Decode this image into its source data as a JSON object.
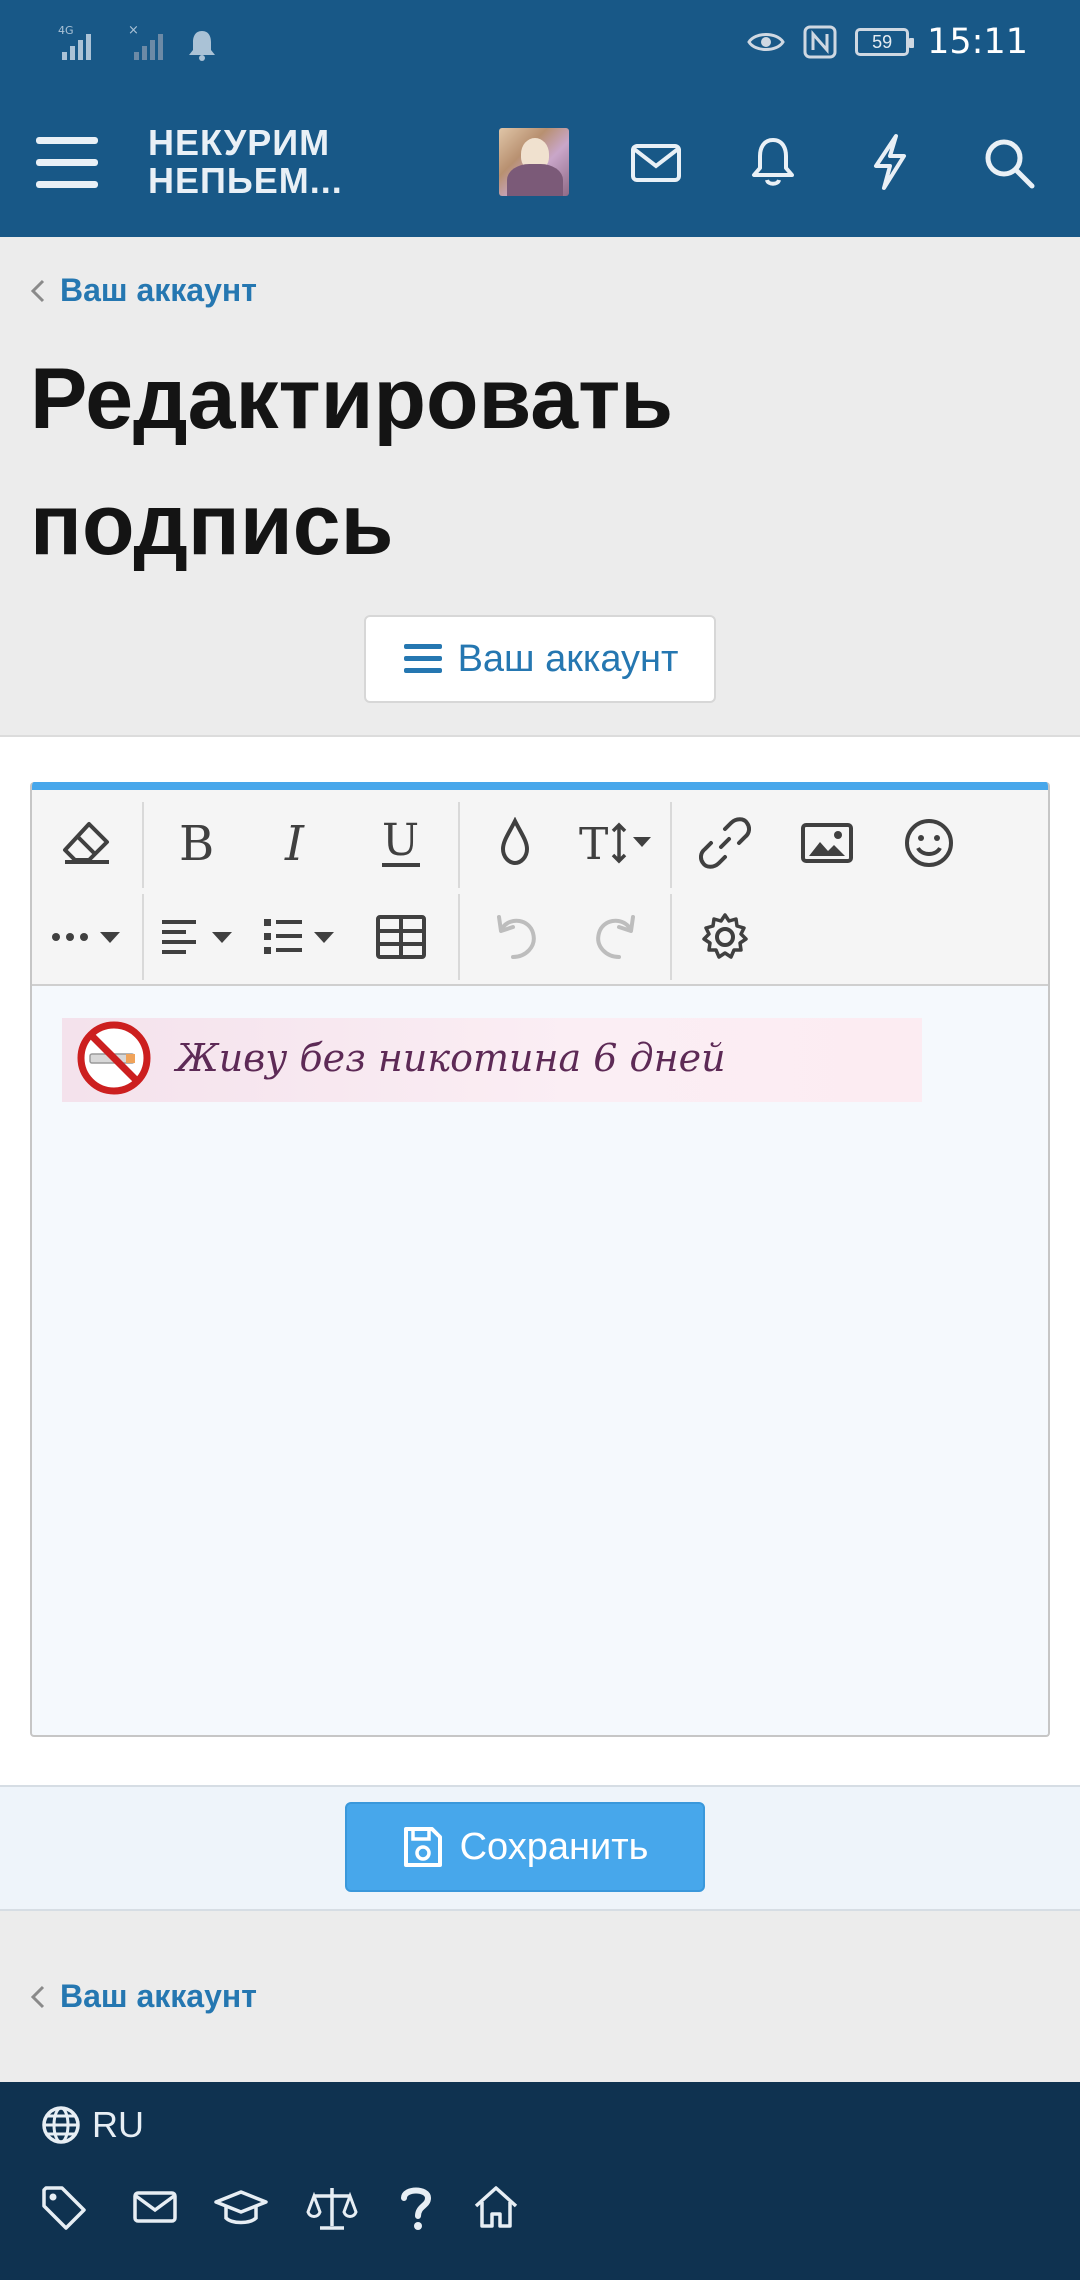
{
  "status_bar": {
    "network": "4G",
    "battery": "59",
    "time": "15:11"
  },
  "app_bar": {
    "logo_line1": "НЕКУРИМ",
    "logo_line2": "НЕПЬЕМ..."
  },
  "breadcrumb_top": "Ваш аккаунт",
  "page_title_line1": "Редактировать",
  "page_title_line2": "подпись",
  "account_menu_button": "Ваш аккаунт",
  "editor": {
    "toolbar_row1": [
      "eraser-icon",
      "bold-icon",
      "italic-icon",
      "underline-icon",
      "color-drop-icon",
      "text-size-icon",
      "link-icon",
      "image-icon",
      "smiley-icon"
    ],
    "toolbar_row2": [
      "more-icon",
      "align-icon",
      "list-icon",
      "table-icon",
      "undo-icon",
      "redo-icon",
      "settings-icon"
    ],
    "signature_text": "Живу без никотина 6 дней"
  },
  "save_button": "Сохранить",
  "breadcrumb_bottom": "Ваш аккаунт",
  "footer": {
    "language": "RU",
    "icons": [
      "tag-icon",
      "mail-icon",
      "graduation-cap-icon",
      "scales-icon",
      "help-icon",
      "home-icon"
    ]
  },
  "colors": {
    "header": "#185887",
    "link": "#2577b1",
    "accent": "#47a7eb",
    "footer": "#0f3250"
  }
}
